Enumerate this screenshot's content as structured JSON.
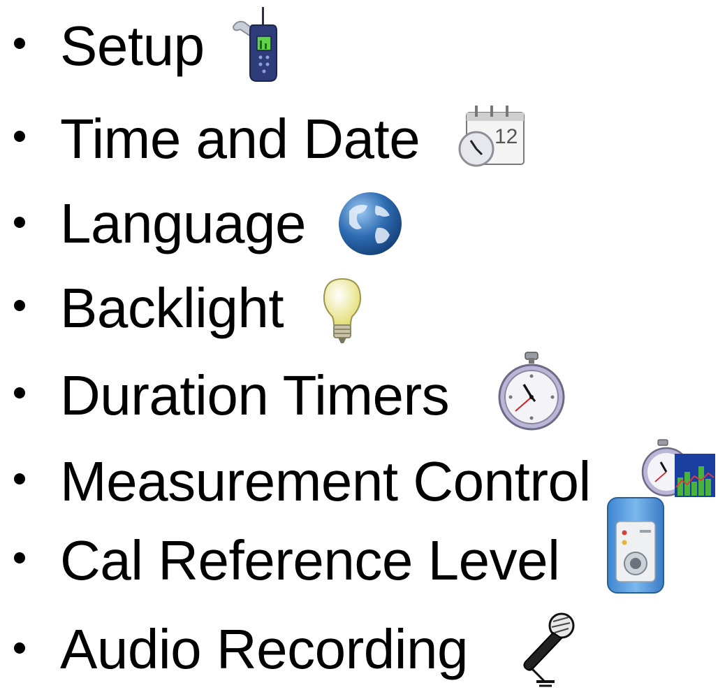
{
  "items": [
    {
      "label": "Setup",
      "icon": "sound-level-meter-with-wrench-icon"
    },
    {
      "label": "Time and Date",
      "icon": "calendar-clock-icon"
    },
    {
      "label": "Language",
      "icon": "globe-icon"
    },
    {
      "label": "Backlight",
      "icon": "light-bulb-icon"
    },
    {
      "label": "Duration Timers",
      "icon": "stopwatch-icon"
    },
    {
      "label": "Measurement Control",
      "icon": "stopwatch-chart-icon"
    },
    {
      "label": "Cal Reference Level",
      "icon": "acoustic-calibrator-icon"
    },
    {
      "label": "Audio Recording",
      "icon": "microphone-icon"
    }
  ],
  "colors": {
    "text": "#000000",
    "background": "#ffffff",
    "globe": "#2f6db3",
    "calibrator": "#5aa0e0",
    "bulb": "#f3f0a8"
  }
}
